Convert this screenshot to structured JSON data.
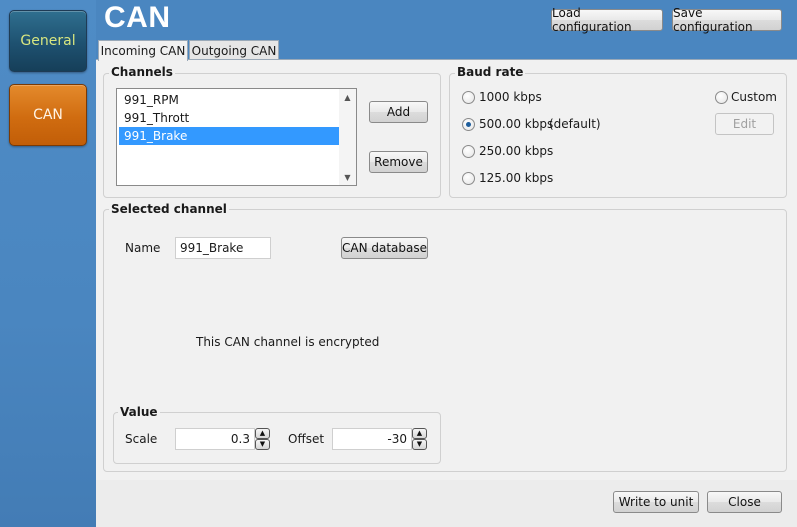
{
  "rail": {
    "general_label": "General",
    "can_label": "CAN"
  },
  "header": {
    "title": "CAN",
    "load_label": "Load configuration",
    "save_label": "Save configuration"
  },
  "tabs": [
    {
      "label": "Incoming CAN",
      "active": true
    },
    {
      "label": "Outgoing CAN",
      "active": false
    }
  ],
  "channels": {
    "group_label": "Channels",
    "items": [
      {
        "label": "991_RPM",
        "selected": false
      },
      {
        "label": "991_Thrott",
        "selected": false
      },
      {
        "label": "991_Brake",
        "selected": true
      }
    ],
    "add_label": "Add",
    "remove_label": "Remove"
  },
  "baud": {
    "group_label": "Baud rate",
    "options": [
      {
        "label": "1000 kbps",
        "checked": false
      },
      {
        "label": "500.00 kbps",
        "note": "(default)",
        "checked": true
      },
      {
        "label": "250.00 kbps",
        "checked": false
      },
      {
        "label": "125.00 kbps",
        "checked": false
      }
    ],
    "custom_label": "Custom",
    "edit_label": "Edit"
  },
  "selected": {
    "group_label": "Selected channel",
    "name_label": "Name",
    "name_value": "991_Brake",
    "database_label": "CAN database",
    "encrypted_text": "This CAN channel is encrypted",
    "value_group_label": "Value",
    "scale_label": "Scale",
    "scale_value": "0.3",
    "offset_label": "Offset",
    "offset_value": "-30"
  },
  "footer": {
    "write_label": "Write to unit",
    "close_label": "Close"
  }
}
